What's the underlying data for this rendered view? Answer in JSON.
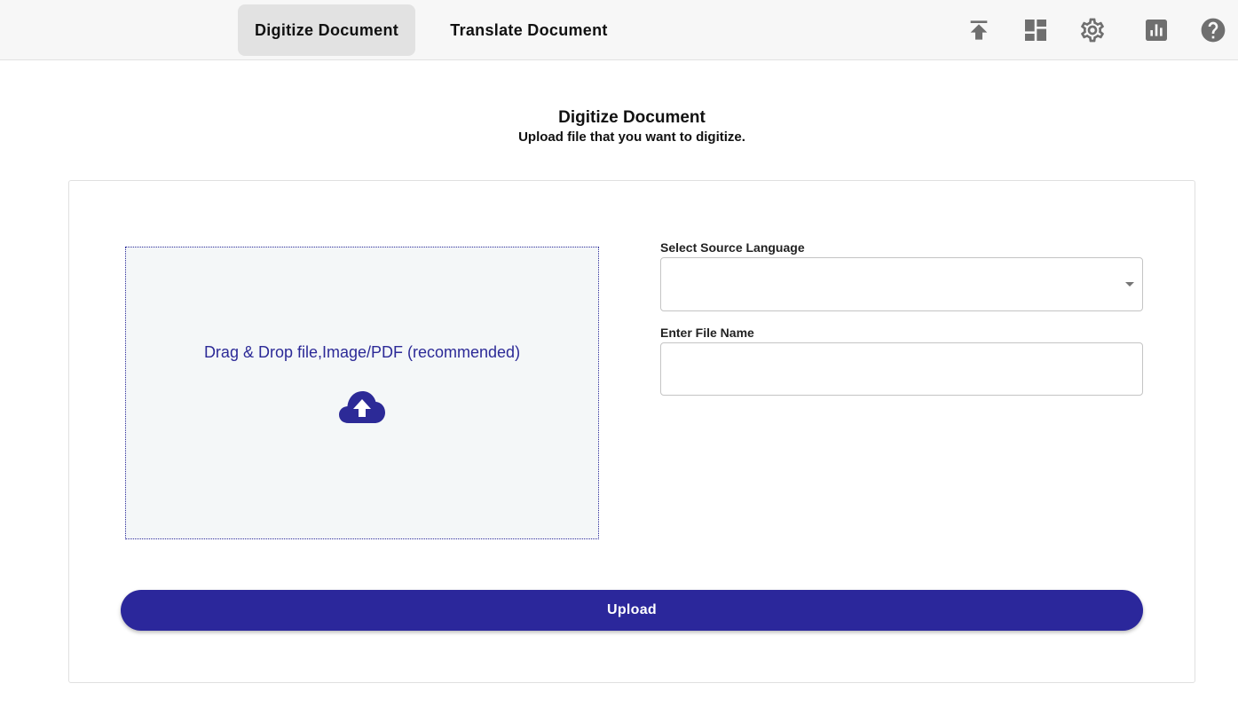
{
  "nav": {
    "tabs": [
      {
        "label": "Digitize Document",
        "active": true
      },
      {
        "label": "Translate Document",
        "active": false
      }
    ],
    "icons": [
      "upload-icon",
      "dashboard-icon",
      "settings-icon",
      "analytics-icon",
      "help-icon"
    ]
  },
  "header": {
    "title": "Digitize Document",
    "subtitle": "Upload file that you want to digitize."
  },
  "dropzone": {
    "text": "Drag & Drop file,Image/PDF (recommended)",
    "icon": "cloud-upload-icon"
  },
  "form": {
    "source_language_label": "Select Source Language",
    "source_language_value": "",
    "file_name_label": "Enter File Name",
    "file_name_value": ""
  },
  "actions": {
    "upload_label": "Upload"
  },
  "colors": {
    "accent": "#2b279b",
    "icon_gray": "#6f6f6f",
    "dropzone_bg": "#f4f7f8"
  }
}
